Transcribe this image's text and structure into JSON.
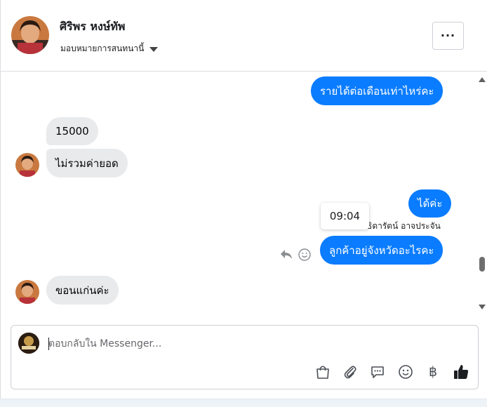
{
  "header": {
    "contact_name": "ศิริพร หงษ์ทัพ",
    "assign_label": "มอบหมายการสนทนานี้",
    "more_label": "···"
  },
  "messages": [
    {
      "direction": "outgoing",
      "text": "รายได้ต่อเดือนเท่าไหร่คะ"
    },
    {
      "direction": "incoming",
      "text": "15000"
    },
    {
      "direction": "incoming",
      "text": "ไม่รวมค่ายอด"
    },
    {
      "direction": "outgoing",
      "text": "ได้ค่ะ"
    },
    {
      "direction": "outgoing",
      "text": "ลูกค้าอยู่จังหวัดอะไรคะ"
    },
    {
      "direction": "incoming",
      "text": "ขอนแก่นค่ะ"
    }
  ],
  "sender_name": "ธิดารัตน์ อาจประจัน",
  "tooltip_time": "09:04",
  "composer": {
    "placeholder": "ตอบกลับใน Messenger...",
    "tools": [
      "shopping-bag-icon",
      "paperclip-icon",
      "saved-reply-icon",
      "emoji-icon",
      "baht-icon",
      "thumbs-up-icon"
    ],
    "baht_symbol": "฿"
  },
  "colors": {
    "outgoing_bubble": "#0a7cff",
    "incoming_bubble": "#e9eaec"
  }
}
